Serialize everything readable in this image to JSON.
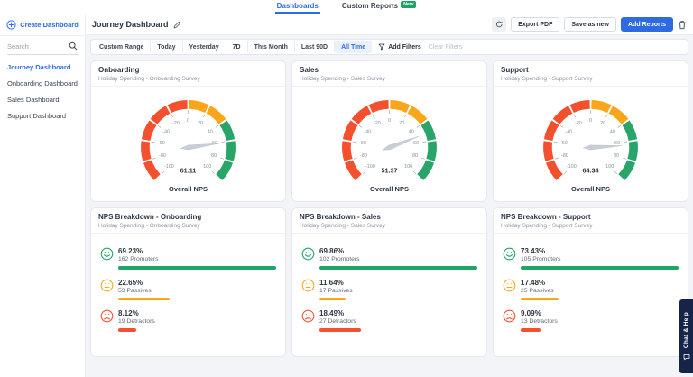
{
  "colors": {
    "accent_blue": "#2e6be0",
    "green": "#1fa566",
    "orange": "#f9a61b",
    "red": "#f4502e",
    "navy": "#16244a"
  },
  "topnav": {
    "tabs": [
      {
        "label": "Dashboards",
        "active": true
      },
      {
        "label": "Custom Reports",
        "active": false,
        "badge": "New"
      }
    ]
  },
  "sidebar": {
    "create_button": "Create Dashboard",
    "search_placeholder": "Search",
    "items": [
      {
        "label": "Journey Dashboard",
        "active": true
      },
      {
        "label": "Onboarding Dashboard",
        "active": false
      },
      {
        "label": "Sales Dashboard",
        "active": false
      },
      {
        "label": "Support Dashboard",
        "active": false
      }
    ]
  },
  "header": {
    "title": "Journey Dashboard",
    "export_pdf": "Export PDF",
    "save_as_new": "Save as new",
    "add_reports": "Add Reports"
  },
  "filterbar": {
    "ranges": [
      "Custom Range",
      "Today",
      "Yesterday",
      "7D",
      "This Month",
      "Last 90D",
      "All Time"
    ],
    "active_range": "All Time",
    "add_filters": "Add Filters",
    "clear_filters": "Clear Filters"
  },
  "chat_tab": {
    "label": "Chat & Help"
  },
  "chart_data": [
    {
      "type": "gauge",
      "title": "Onboarding",
      "subtitle": "Holiday Spending - Onboarding Survey",
      "value": 61.11,
      "value_label": "61.11",
      "axis_label": "Overall NPS",
      "min": -100,
      "max": 100,
      "tick_step": 20,
      "ticks": [
        -100,
        -80,
        -60,
        -40,
        -20,
        0,
        20,
        40,
        60,
        80,
        100
      ],
      "segments": [
        {
          "from": -100,
          "to": 0,
          "color": "#f4502e"
        },
        {
          "from": 0,
          "to": 40,
          "color": "#f9a61b"
        },
        {
          "from": 40,
          "to": 100,
          "color": "#2aa56a"
        }
      ]
    },
    {
      "type": "gauge",
      "title": "Sales",
      "subtitle": "Holiday Spending - Sales Survey",
      "value": 51.37,
      "value_label": "51.37",
      "axis_label": "Overall NPS",
      "min": -100,
      "max": 100,
      "tick_step": 20,
      "ticks": [
        -100,
        -80,
        -60,
        -40,
        -20,
        0,
        20,
        40,
        60,
        80,
        100
      ],
      "segments": [
        {
          "from": -100,
          "to": 0,
          "color": "#f4502e"
        },
        {
          "from": 0,
          "to": 40,
          "color": "#f9a61b"
        },
        {
          "from": 40,
          "to": 100,
          "color": "#2aa56a"
        }
      ]
    },
    {
      "type": "gauge",
      "title": "Support",
      "subtitle": "Holiday Spending - Support Survey",
      "value": 64.34,
      "value_label": "64.34",
      "axis_label": "Overall NPS",
      "min": -100,
      "max": 100,
      "tick_step": 20,
      "ticks": [
        -100,
        -80,
        -60,
        -40,
        -20,
        0,
        20,
        40,
        60,
        80,
        100
      ],
      "segments": [
        {
          "from": -100,
          "to": 0,
          "color": "#f4502e"
        },
        {
          "from": 0,
          "to": 40,
          "color": "#f9a61b"
        },
        {
          "from": 40,
          "to": 100,
          "color": "#2aa56a"
        }
      ]
    },
    {
      "type": "bar",
      "title": "NPS Breakdown - Onboarding",
      "subtitle": "Holiday Spending - Onboarding Survey",
      "rows": [
        {
          "percent": "69.23%",
          "label": "162 Promoters",
          "value": 69.23,
          "color": "#1fa566",
          "icon": "smile"
        },
        {
          "percent": "22.65%",
          "label": "53 Passives",
          "value": 22.65,
          "color": "#f9a61b",
          "icon": "neutral"
        },
        {
          "percent": "8.12%",
          "label": "19 Detractors",
          "value": 8.12,
          "color": "#f4502e",
          "icon": "frown"
        }
      ]
    },
    {
      "type": "bar",
      "title": "NPS Breakdown - Sales",
      "subtitle": "Holiday Spending - Sales Survey",
      "rows": [
        {
          "percent": "69.86%",
          "label": "102 Promoters",
          "value": 69.86,
          "color": "#1fa566",
          "icon": "smile"
        },
        {
          "percent": "11.64%",
          "label": "17 Passives",
          "value": 11.64,
          "color": "#f9a61b",
          "icon": "neutral"
        },
        {
          "percent": "18.49%",
          "label": "27 Detractors",
          "value": 18.49,
          "color": "#f4502e",
          "icon": "frown"
        }
      ]
    },
    {
      "type": "bar",
      "title": "NPS Breakdown - Support",
      "subtitle": "Holiday Spending - Support Survey",
      "rows": [
        {
          "percent": "73.43%",
          "label": "105 Promoters",
          "value": 73.43,
          "color": "#1fa566",
          "icon": "smile"
        },
        {
          "percent": "17.48%",
          "label": "25 Passives",
          "value": 17.48,
          "color": "#f9a61b",
          "icon": "neutral"
        },
        {
          "percent": "9.09%",
          "label": "13 Detractors",
          "value": 9.09,
          "color": "#f4502e",
          "icon": "frown"
        }
      ]
    }
  ]
}
